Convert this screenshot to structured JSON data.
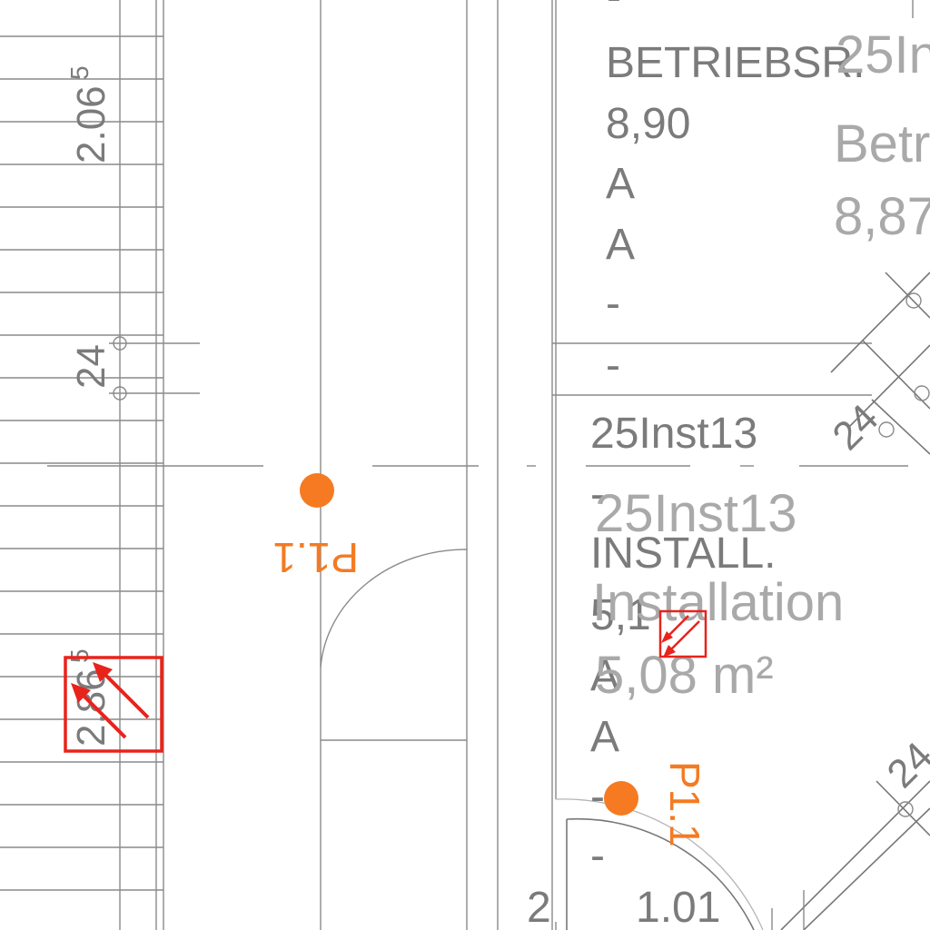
{
  "dims": {
    "d1": "2.06",
    "d1_sup": "5",
    "d2": "24",
    "d3": "2.86",
    "d3_sup": "5",
    "d4": "24",
    "d5": "24",
    "d6": "1.01",
    "d7": "2"
  },
  "room_dark_1": {
    "dash_top": "-",
    "name": "BETRIEBSR.",
    "area": "8,90",
    "line_a1": "A",
    "line_a2": "A",
    "dash1": "-",
    "dash2": "-"
  },
  "room_light_1": {
    "code": "25In",
    "name": "Betr",
    "area": "8,87"
  },
  "room_dark_2": {
    "code": "25Inst13",
    "dash_top": "-",
    "name": "INSTALL.",
    "area": "5,1",
    "line_a1": "A",
    "line_a2": "A",
    "dash1": "-",
    "dash2": "-"
  },
  "room_light_2": {
    "code": "25Inst13",
    "name": "Installation",
    "area": "5,08 m²"
  },
  "markers": {
    "p1_left": "P1.1",
    "p1_right": "P1.1"
  },
  "colors": {
    "marker": "#f57a22",
    "symbol": "#e8231c",
    "line": "#8a8a8a"
  }
}
